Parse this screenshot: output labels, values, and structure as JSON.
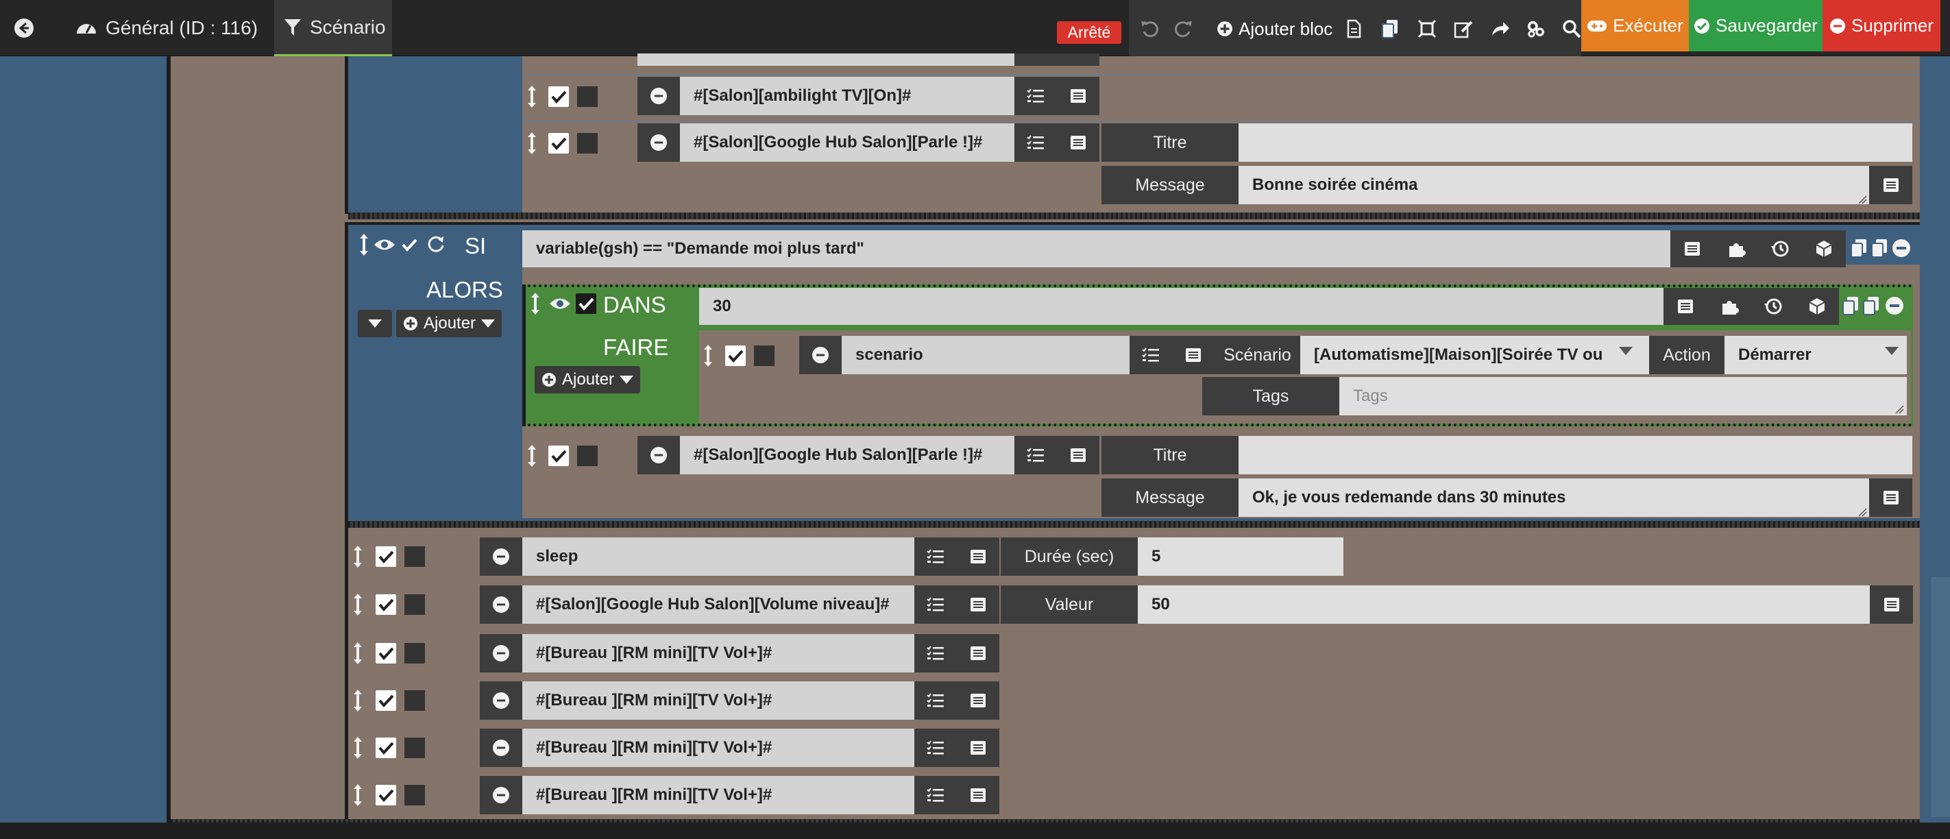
{
  "header": {
    "back_icon": "arrow-circle-left-icon",
    "general_label": "Général (ID : 116)",
    "scenario_tab": "Scénario",
    "status_badge": "Arrêté",
    "add_block_label": "Ajouter bloc",
    "run_label": "Exécuter",
    "save_label": "Sauvegarder",
    "delete_label": "Supprimer",
    "colors": {
      "run": "#e67e22",
      "save": "#2f9e47",
      "delete": "#d9342b",
      "stopped": "#d9342b"
    }
  },
  "top_block": {
    "actions": [
      {
        "cmd": "#[Salon][ambilight TV][On]#"
      },
      {
        "cmd": "#[Salon][Google Hub Salon][Parle !]#",
        "title_label": "Titre",
        "title_value": "",
        "message_label": "Message",
        "message_value": "Bonne soirée cinéma"
      }
    ]
  },
  "si_block": {
    "si_label": "SI",
    "alors_label": "ALORS",
    "add_label": "Ajouter",
    "condition": "variable(gsh) == \"Demande moi plus tard\"",
    "dans_block": {
      "dans_label": "DANS",
      "faire_label": "FAIRE",
      "add_label": "Ajouter",
      "delay": "30",
      "action": {
        "cmd": "scenario",
        "scenario_label": "Scénario",
        "scenario_value": "[Automatisme][Maison][Soirée TV ou cinéma]",
        "action_label": "Action",
        "action_value": "Démarrer",
        "tags_label": "Tags",
        "tags_placeholder": "Tags"
      }
    },
    "after_action": {
      "cmd": "#[Salon][Google Hub Salon][Parle !]#",
      "title_label": "Titre",
      "title_value": "",
      "message_label": "Message",
      "message_value": "Ok, je vous redemande dans 30 minutes"
    }
  },
  "bottom_actions": {
    "sleep": {
      "cmd": "sleep",
      "label": "Durée (sec)",
      "value": "5"
    },
    "volume": {
      "cmd": "#[Salon][Google Hub Salon][Volume niveau]#",
      "label": "Valeur",
      "value": "50"
    },
    "vol_plus": [
      {
        "cmd": "#[Bureau ][RM mini][TV Vol+]#"
      },
      {
        "cmd": "#[Bureau ][RM mini][TV Vol+]#"
      },
      {
        "cmd": "#[Bureau ][RM mini][TV Vol+]#"
      },
      {
        "cmd": "#[Bureau ][RM mini][TV Vol+]#"
      }
    ]
  }
}
